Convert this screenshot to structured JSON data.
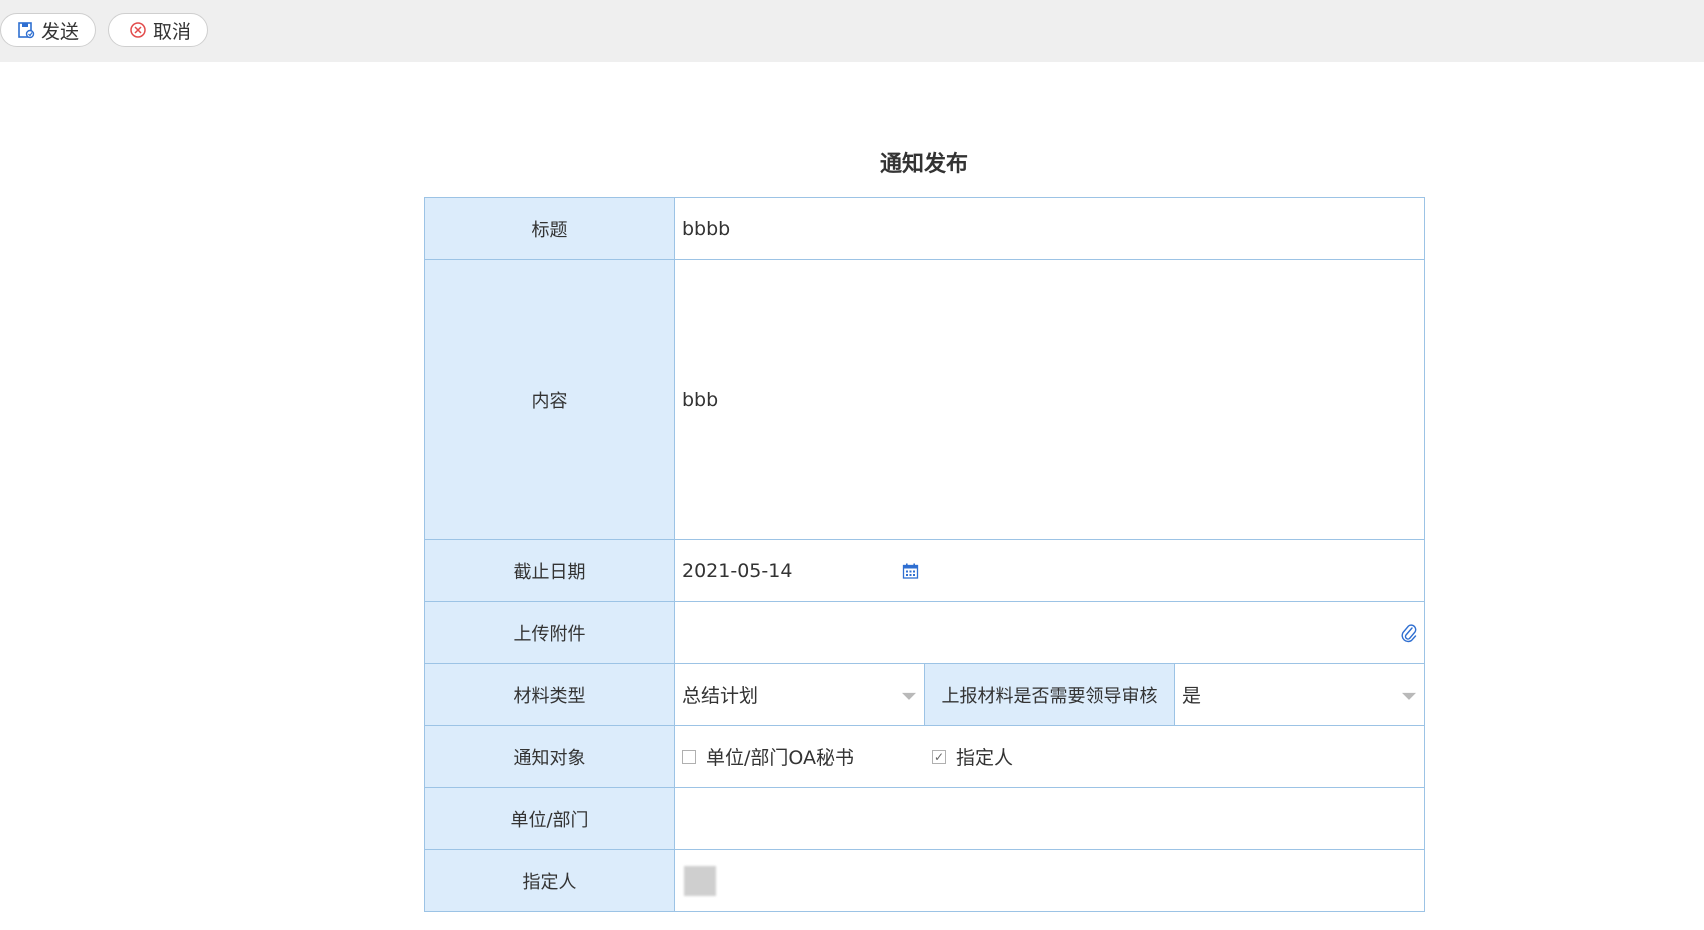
{
  "toolbar": {
    "send_label": "发送",
    "cancel_label": "取消"
  },
  "form": {
    "title": "通知发布",
    "rows": {
      "title_label": "标题",
      "title_value": "bbbb",
      "content_label": "内容",
      "content_value": "bbb",
      "deadline_label": "截止日期",
      "deadline_value": "2021-05-14",
      "attachment_label": "上传附件",
      "material_type_label": "材料类型",
      "material_type_value": "总结计划",
      "review_label": "上报材料是否需要领导审核",
      "review_value": "是",
      "notify_target_label": "通知对象",
      "notify_option_1": "单位/部门OA秘书",
      "notify_option_1_checked": false,
      "notify_option_2": "指定人",
      "notify_option_2_checked": true,
      "unit_label": "单位/部门",
      "assignee_label": "指定人"
    }
  },
  "colors": {
    "label_bg": "#dcecfb",
    "border": "#9cc3e5",
    "accent": "#2f6fd1"
  },
  "icons": [
    "save-icon",
    "cancel-icon",
    "calendar-icon",
    "paperclip-icon",
    "dropdown-caret-icon",
    "checkbox-icon"
  ]
}
